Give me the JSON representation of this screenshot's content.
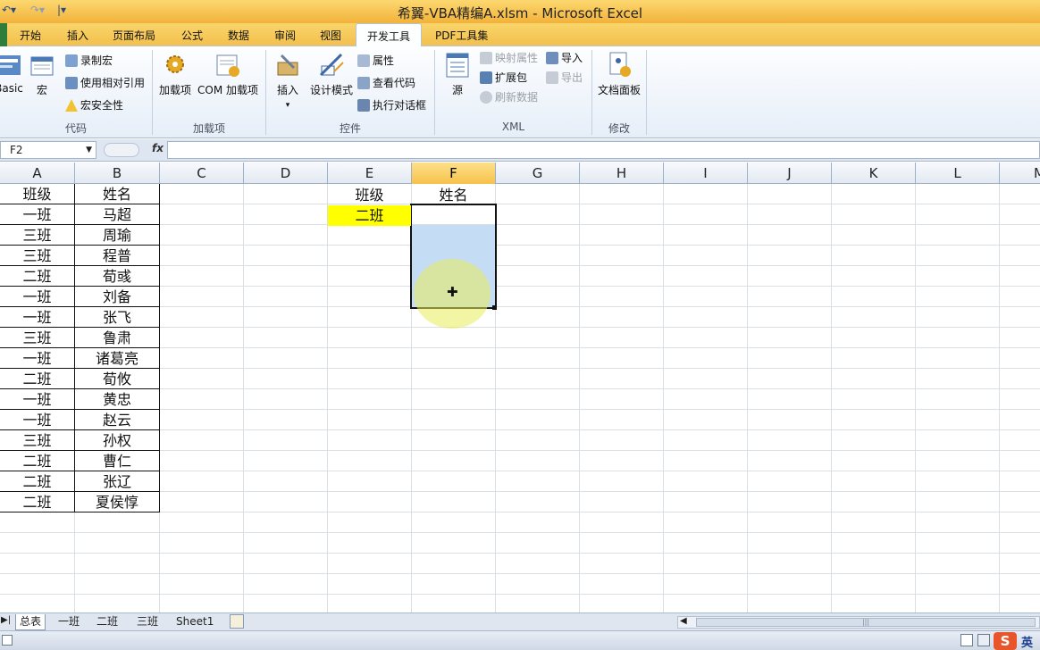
{
  "window": {
    "title": "希翼-VBA精编A.xlsm - Microsoft Excel"
  },
  "tabs": [
    "开始",
    "插入",
    "页面布局",
    "公式",
    "数据",
    "审阅",
    "视图",
    "开发工具",
    "PDF工具集"
  ],
  "active_tab": "开发工具",
  "ribbon": {
    "code_group": {
      "label": "代码",
      "basic": "Basic",
      "macro": "宏",
      "record": "录制宏",
      "relative": "使用相对引用",
      "security": "宏安全性"
    },
    "addins_group": {
      "label": "加载项",
      "addins": "加载项",
      "com_addins": "COM 加载项"
    },
    "controls_group": {
      "label": "控件",
      "insert": "插入",
      "design_mode": "设计模式",
      "properties": "属性",
      "view_code": "查看代码",
      "run_dialog": "执行对话框"
    },
    "xml_group": {
      "label": "XML",
      "source": "源",
      "map_props": "映射属性",
      "expansion": "扩展包",
      "refresh": "刷新数据",
      "import": "导入",
      "export": "导出"
    },
    "modify_group": {
      "label": "修改",
      "doc_panel": "文档面板"
    }
  },
  "formula_bar": {
    "name_box": "F2",
    "fx": "fx",
    "formula": ""
  },
  "columns": [
    "A",
    "B",
    "C",
    "D",
    "E",
    "F",
    "G",
    "H",
    "I",
    "J",
    "K",
    "L",
    "M"
  ],
  "selected_column": "F",
  "table": {
    "headers": [
      "班级",
      "姓名"
    ],
    "rows": [
      [
        "一班",
        "马超"
      ],
      [
        "三班",
        "周瑜"
      ],
      [
        "三班",
        "程普"
      ],
      [
        "二班",
        "荀彧"
      ],
      [
        "一班",
        "刘备"
      ],
      [
        "一班",
        "张飞"
      ],
      [
        "三班",
        "鲁肃"
      ],
      [
        "一班",
        "诸葛亮"
      ],
      [
        "二班",
        "荀攸"
      ],
      [
        "一班",
        "黄忠"
      ],
      [
        "一班",
        "赵云"
      ],
      [
        "三班",
        "孙权"
      ],
      [
        "二班",
        "曹仁"
      ],
      [
        "二班",
        "张辽"
      ],
      [
        "二班",
        "夏侯惇"
      ]
    ]
  },
  "criteria": {
    "header_class": "班级",
    "header_name": "姓名",
    "value": "二班",
    "highlight": "#ffff00"
  },
  "sheet_tabs": [
    "总表",
    "一班",
    "二班",
    "三班",
    "Sheet1"
  ],
  "active_sheet": "总表",
  "status": {
    "ime": "英"
  },
  "colors": {
    "accent": "#f6c34c",
    "selection": "#c5dcf5",
    "grid": "#dadfe6"
  }
}
